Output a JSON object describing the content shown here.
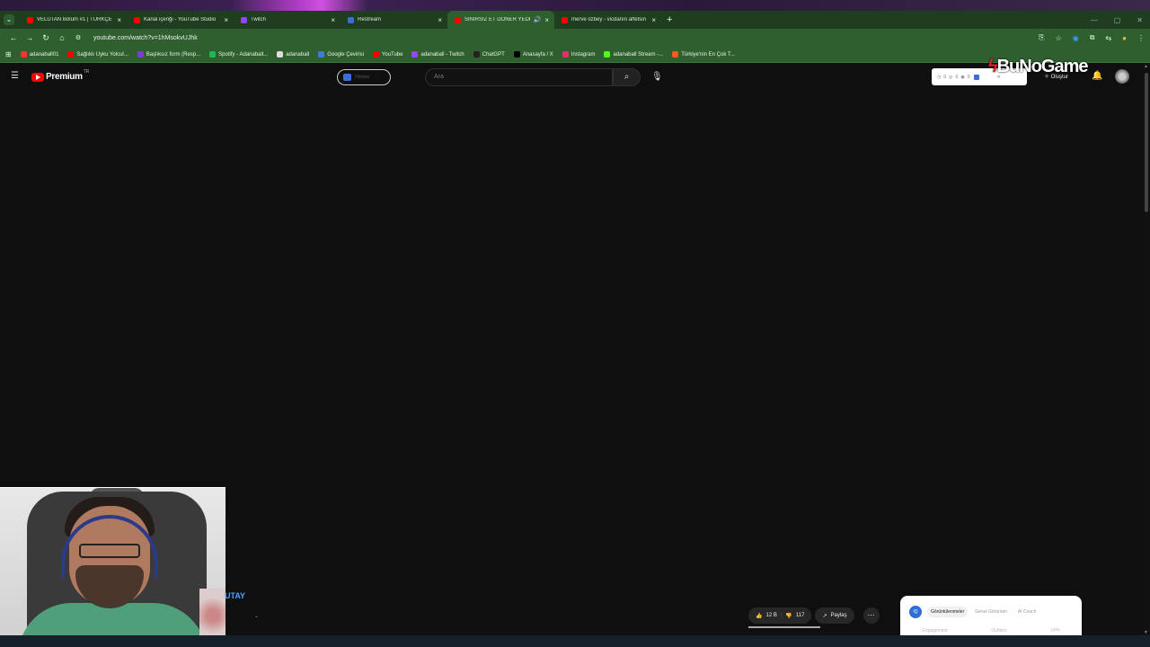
{
  "browser": {
    "tabs": [
      {
        "title": "VELUTAN Bölüm #1 | TÜRKÇE I",
        "color": "#ff0000",
        "active": false
      },
      {
        "title": "Kanal içeriği - YouTube Studio",
        "color": "#ff0000",
        "active": false
      },
      {
        "title": "Twitch",
        "color": "#9146ff",
        "active": false
      },
      {
        "title": "Restream",
        "color": "#3b6fd8",
        "active": false
      },
      {
        "title": "SINIRSIZ ET DÖNER YEDİK!",
        "color": "#ff0000",
        "active": true
      },
      {
        "title": "merve özbey - vicdanın affetsin",
        "color": "#ff0000",
        "active": false
      }
    ],
    "new_tab": "+",
    "url": "youtube.com/watch?v=1hMsokvUJhk",
    "bookmarks": [
      {
        "label": "adanaball01",
        "color": "#ff3333"
      },
      {
        "label": "Sağlıklı Uyku Yolcul...",
        "color": "#ff0000"
      },
      {
        "label": "Başlıksız form (Resp...",
        "color": "#7b3fd0"
      },
      {
        "label": "Spotify - Adanaball...",
        "color": "#1db954"
      },
      {
        "label": "adanaball",
        "color": "#dddddd"
      },
      {
        "label": "Google Çevirisi",
        "color": "#3b7ddd"
      },
      {
        "label": "YouTube",
        "color": "#ff0000"
      },
      {
        "label": "adanaball - Twitch",
        "color": "#9146ff"
      },
      {
        "label": "ChatGPT",
        "color": "#222222"
      },
      {
        "label": "Anasayfa / X",
        "color": "#000000"
      },
      {
        "label": "Instagram",
        "color": "#e1306c"
      },
      {
        "label": "adanaball Stream -...",
        "color": "#53fc18"
      },
      {
        "label": "Türkiye'nin En Çok T...",
        "color": "#ff5a1f"
      }
    ]
  },
  "youtube": {
    "logo_text": "Premium",
    "logo_sup": "TR",
    "filter_label": "Filtreler",
    "search_placeholder": "Ara",
    "ext_stats": [
      "0",
      "0",
      "0"
    ],
    "brand_overlay": "BuNoGame",
    "create_label": "Oluştur",
    "channel_name": "UTAY",
    "like_count": "12 B",
    "dislike_count": "117",
    "share_label": "Paylaş",
    "vidiq": {
      "tabs": [
        "Görüntülenmeler",
        "Genel Görünüm",
        "AI Coach"
      ],
      "bottom": [
        "Engagement",
        "Outliers",
        "VPH"
      ]
    }
  }
}
